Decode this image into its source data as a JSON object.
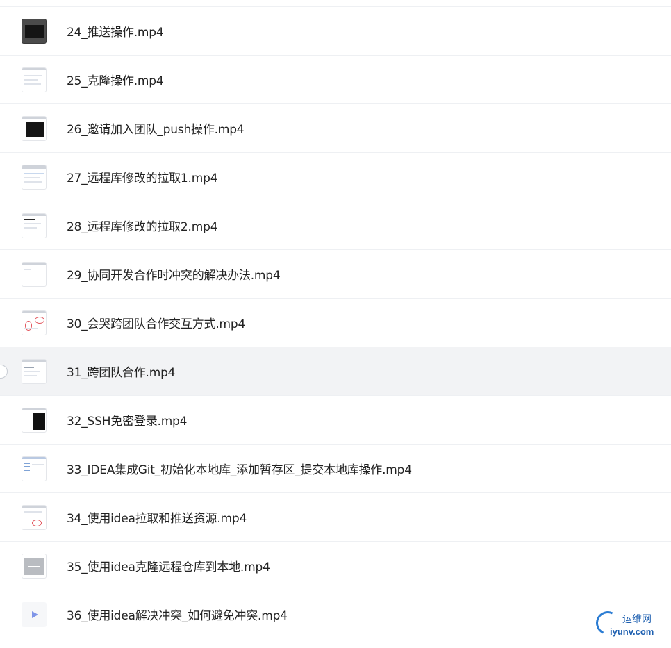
{
  "files": [
    {
      "name": "24_推送操作.mp4",
      "thumb": "dark-terminal"
    },
    {
      "name": "25_克隆操作.mp4",
      "thumb": "light-window"
    },
    {
      "name": "26_邀请加入团队_push操作.mp4",
      "thumb": "terminal"
    },
    {
      "name": "27_远程库修改的拉取1.mp4",
      "thumb": "light-window"
    },
    {
      "name": "28_远程库修改的拉取2.mp4",
      "thumb": "light-window"
    },
    {
      "name": "29_协同开发合作时冲突的解决办法.mp4",
      "thumb": "light-window"
    },
    {
      "name": "30_会哭跨团队合作交互方式.mp4",
      "thumb": "annotated-window"
    },
    {
      "name": "31_跨团队合作.mp4",
      "thumb": "light-window"
    },
    {
      "name": "32_SSH免密登录.mp4",
      "thumb": "black-block"
    },
    {
      "name": "33_IDEA集成Git_初始化本地库_添加暂存区_提交本地库操作.mp4",
      "thumb": "ide-window"
    },
    {
      "name": "34_使用idea拉取和推送资源.mp4",
      "thumb": "annotated-window"
    },
    {
      "name": "35_使用idea克隆远程仓库到本地.mp4",
      "thumb": "gray-window"
    },
    {
      "name": "36_使用idea解决冲突_如何避免冲突.mp4",
      "thumb": "play-icon"
    }
  ],
  "hovered_index": 7,
  "watermark": {
    "cn": "运维网",
    "en": "iyunv.com"
  },
  "colors": {
    "hover_row": "#f2f3f5",
    "divider": "#eef0f3",
    "watermark_blue": "#1d5fb0"
  }
}
